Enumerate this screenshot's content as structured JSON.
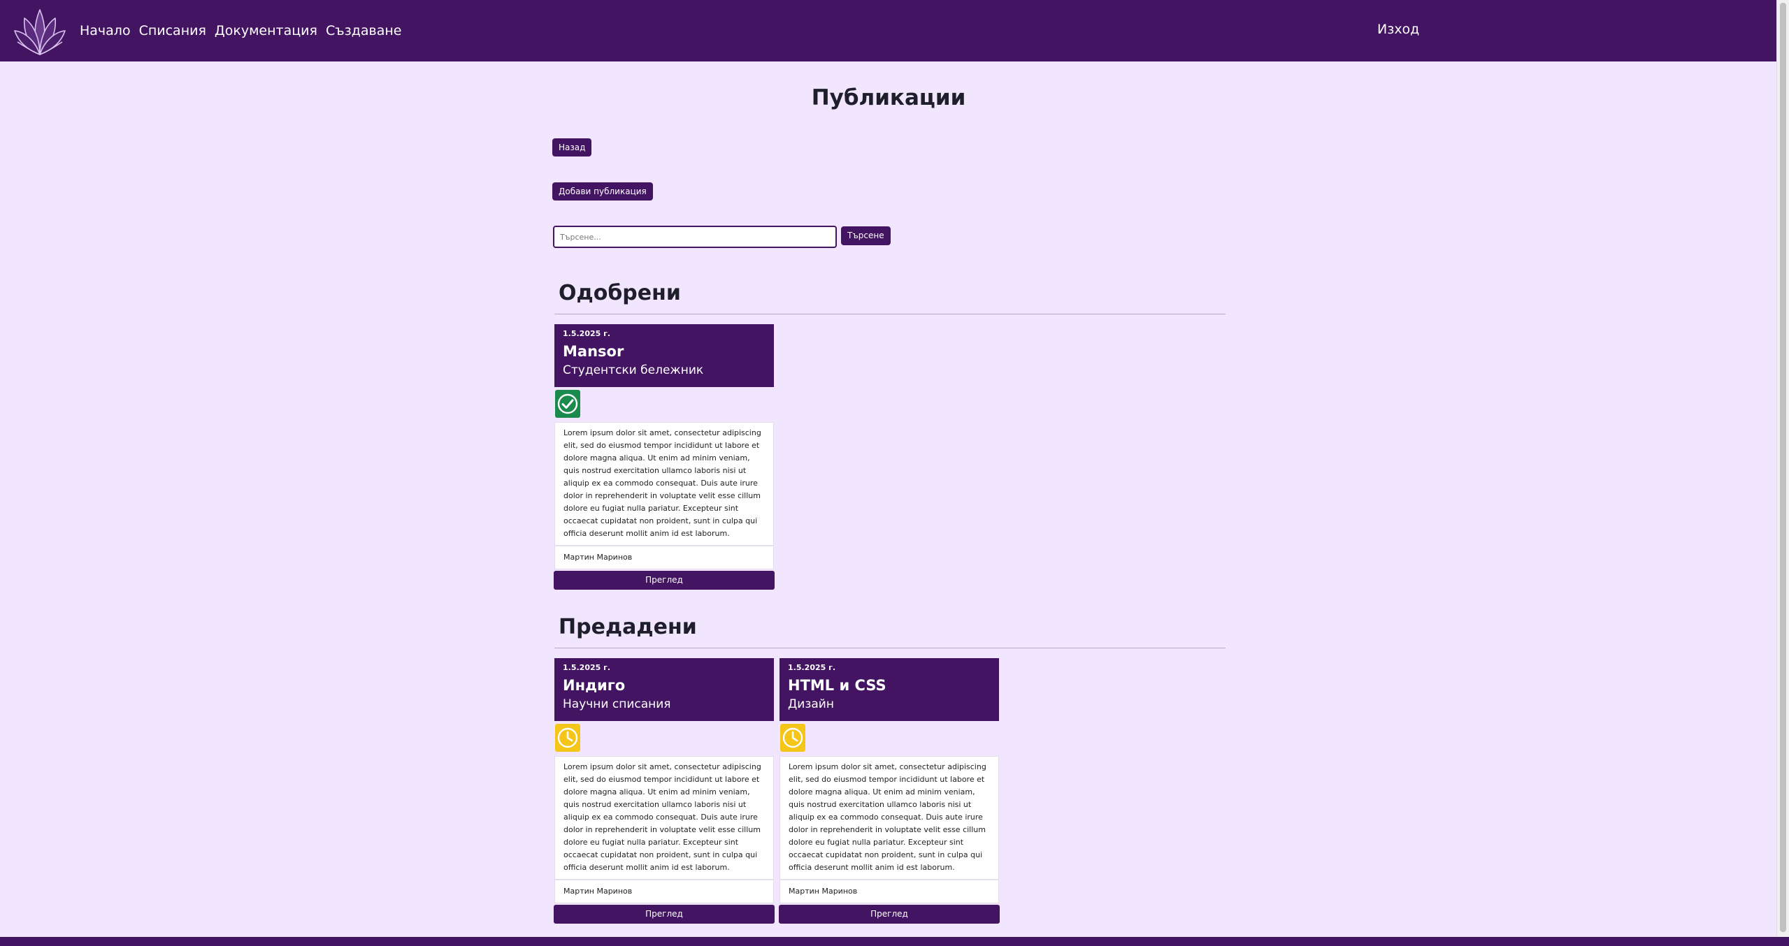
{
  "nav": {
    "links": [
      {
        "label": "Начало"
      },
      {
        "label": "Списания"
      },
      {
        "label": "Документация"
      },
      {
        "label": "Създаване"
      }
    ],
    "logout": "Изход",
    "logo_icon": "lotus-logo-icon"
  },
  "page": {
    "title": "Публикации",
    "back_label": "Назад",
    "add_label": "Добави публикация",
    "search_placeholder": "Търсене...",
    "search_button": "Търсене"
  },
  "colors": {
    "primary": "#431462",
    "background": "#f1e6fe",
    "approved": "#1b8a4d",
    "pending": "#f5c518"
  },
  "sections": [
    {
      "title": "Одобрени",
      "cards": [
        {
          "date": "1.5.2025 г.",
          "title": "Mansor",
          "subtitle": "Студентски бележник",
          "status_icon": "check-circle-icon",
          "body": "Lorem ipsum dolor sit amet, consectetur adipiscing elit, sed do eiusmod tempor incididunt ut labore et dolore magna aliqua. Ut enim ad minim veniam, quis nostrud exercitation ullamco laboris nisi ut aliquip ex ea commodo consequat. Duis aute irure dolor in reprehenderit in voluptate velit esse cillum dolore eu fugiat nulla pariatur. Excepteur sint occaecat cupidatat non proident, sunt in culpa qui officia deserunt mollit anim id est laborum.",
          "author": "Мартин Маринов",
          "button": "Преглед"
        }
      ]
    },
    {
      "title": "Предадени",
      "cards": [
        {
          "date": "1.5.2025 г.",
          "title": "Индиго",
          "subtitle": "Научни списания",
          "status_icon": "clock-icon",
          "body": "Lorem ipsum dolor sit amet, consectetur adipiscing elit, sed do eiusmod tempor incididunt ut labore et dolore magna aliqua. Ut enim ad minim veniam, quis nostrud exercitation ullamco laboris nisi ut aliquip ex ea commodo consequat. Duis aute irure dolor in reprehenderit in voluptate velit esse cillum dolore eu fugiat nulla pariatur. Excepteur sint occaecat cupidatat non proident, sunt in culpa qui officia deserunt mollit anim id est laborum.",
          "author": "Мартин Маринов",
          "button": "Преглед"
        },
        {
          "date": "1.5.2025 г.",
          "title": "HTML и CSS",
          "subtitle": "Дизайн",
          "status_icon": "clock-icon",
          "body": "Lorem ipsum dolor sit amet, consectetur adipiscing elit, sed do eiusmod tempor incididunt ut labore et dolore magna aliqua. Ut enim ad minim veniam, quis nostrud exercitation ullamco laboris nisi ut aliquip ex ea commodo consequat. Duis aute irure dolor in reprehenderit in voluptate velit esse cillum dolore eu fugiat nulla pariatur. Excepteur sint occaecat cupidatat non proident, sunt in culpa qui officia deserunt mollit anim id est laborum.",
          "author": "Мартин Маринов",
          "button": "Преглед"
        }
      ]
    }
  ]
}
